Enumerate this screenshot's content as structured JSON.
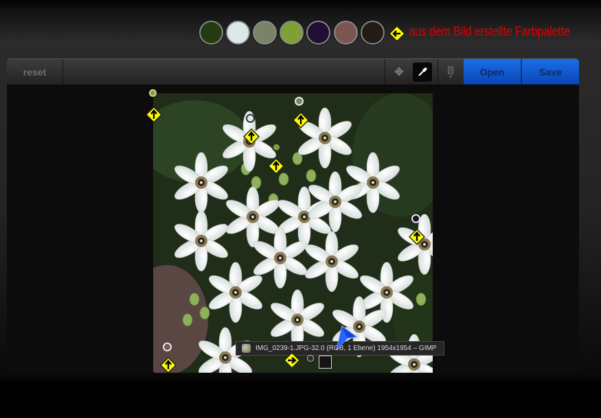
{
  "palette": {
    "colors": [
      "#253b13",
      "#dde8ea",
      "#7b8367",
      "#7ea037",
      "#1f1033",
      "#7c5651",
      "#231b18"
    ],
    "caption": "aus dem Bild erstellte Farbpalette",
    "caption_color": "#e00000"
  },
  "toolbar": {
    "reset_label": "reset",
    "move_icon": "move-icon",
    "picker_icon": "eyedropper-icon",
    "palette_icon": "palette-icon",
    "open_label": "Open",
    "save_label": "Save",
    "accent": "#0a55d0"
  },
  "sample_markers": [
    {
      "color": "#7ea037",
      "arrow": "up"
    },
    {
      "color": "#dde8ea",
      "arrow": "up"
    },
    {
      "color": "#7b8367",
      "arrow": "up"
    },
    {
      "color": "#7ea037",
      "arrow": "up"
    },
    {
      "color": "#1f1033",
      "arrow": "up"
    },
    {
      "color": "#7c5651",
      "arrow": "up"
    },
    {
      "color": "#231b18",
      "arrow": "right"
    }
  ],
  "tooltip": {
    "text": "IMG_0239-1.JPG-32.0 (RGB, 1 Ebene) 1954x1954 – GIMP"
  },
  "annotation_sign_color": "#ffff00"
}
